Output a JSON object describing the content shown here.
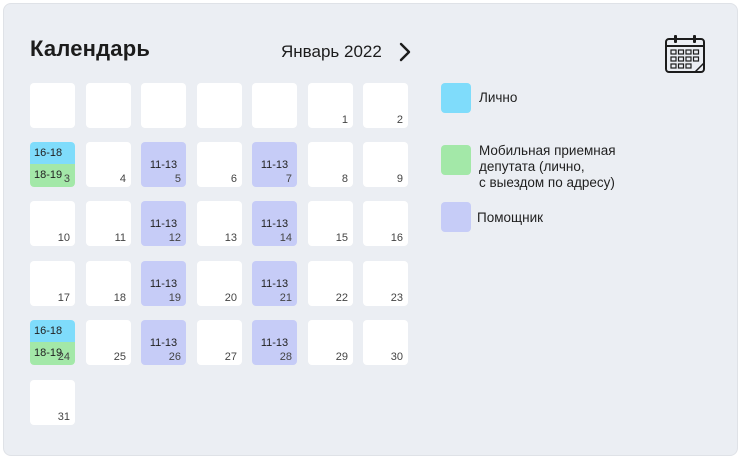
{
  "header": {
    "title": "Календарь",
    "month": "Январь 2022"
  },
  "colors": {
    "personal": "#7fdcfb",
    "mobile": "#a3e8a8",
    "assistant": "#c6ccf7",
    "panel": "#ebeef3"
  },
  "icons": {
    "next": "chevron-right-icon",
    "calendar": "calendar-icon"
  },
  "legend": {
    "personal": "Лично",
    "mobile_line1": "Мобильная приемная",
    "mobile_line2": "депутата (лично,",
    "mobile_line3": "с выездом по адресу)",
    "assistant": "Помощник"
  },
  "days": [
    {
      "day": "1"
    },
    {
      "day": "2"
    },
    {
      "day": "3",
      "top": "16-18",
      "bottom": "18-19"
    },
    {
      "day": "4"
    },
    {
      "day": "5",
      "time": "11-13"
    },
    {
      "day": "6"
    },
    {
      "day": "7",
      "time": "11-13"
    },
    {
      "day": "8"
    },
    {
      "day": "9"
    },
    {
      "day": "10"
    },
    {
      "day": "11"
    },
    {
      "day": "12",
      "time": "11-13"
    },
    {
      "day": "13"
    },
    {
      "day": "14",
      "time": "11-13"
    },
    {
      "day": "15"
    },
    {
      "day": "16"
    },
    {
      "day": "17"
    },
    {
      "day": "18"
    },
    {
      "day": "19",
      "time": "11-13"
    },
    {
      "day": "20"
    },
    {
      "day": "21",
      "time": "11-13"
    },
    {
      "day": "22"
    },
    {
      "day": "23"
    },
    {
      "day": "24",
      "top": "16-18",
      "bottom": "18-19"
    },
    {
      "day": "25"
    },
    {
      "day": "26",
      "time": "11-13"
    },
    {
      "day": "27"
    },
    {
      "day": "28",
      "time": "11-13"
    },
    {
      "day": "29"
    },
    {
      "day": "30"
    },
    {
      "day": "31"
    }
  ]
}
